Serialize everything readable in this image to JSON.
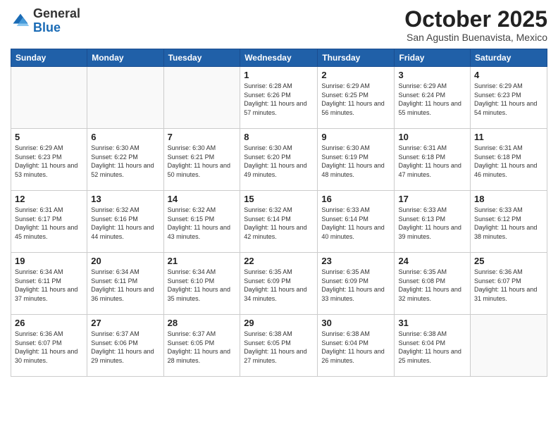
{
  "header": {
    "logo_line1": "General",
    "logo_line2": "Blue",
    "month": "October 2025",
    "location": "San Agustin Buenavista, Mexico"
  },
  "weekdays": [
    "Sunday",
    "Monday",
    "Tuesday",
    "Wednesday",
    "Thursday",
    "Friday",
    "Saturday"
  ],
  "weeks": [
    [
      {
        "day": "",
        "sunrise": "",
        "sunset": "",
        "daylight": ""
      },
      {
        "day": "",
        "sunrise": "",
        "sunset": "",
        "daylight": ""
      },
      {
        "day": "",
        "sunrise": "",
        "sunset": "",
        "daylight": ""
      },
      {
        "day": "1",
        "sunrise": "6:28 AM",
        "sunset": "6:26 PM",
        "daylight": "11 hours and 57 minutes."
      },
      {
        "day": "2",
        "sunrise": "6:29 AM",
        "sunset": "6:25 PM",
        "daylight": "11 hours and 56 minutes."
      },
      {
        "day": "3",
        "sunrise": "6:29 AM",
        "sunset": "6:24 PM",
        "daylight": "11 hours and 55 minutes."
      },
      {
        "day": "4",
        "sunrise": "6:29 AM",
        "sunset": "6:23 PM",
        "daylight": "11 hours and 54 minutes."
      }
    ],
    [
      {
        "day": "5",
        "sunrise": "6:29 AM",
        "sunset": "6:23 PM",
        "daylight": "11 hours and 53 minutes."
      },
      {
        "day": "6",
        "sunrise": "6:30 AM",
        "sunset": "6:22 PM",
        "daylight": "11 hours and 52 minutes."
      },
      {
        "day": "7",
        "sunrise": "6:30 AM",
        "sunset": "6:21 PM",
        "daylight": "11 hours and 50 minutes."
      },
      {
        "day": "8",
        "sunrise": "6:30 AM",
        "sunset": "6:20 PM",
        "daylight": "11 hours and 49 minutes."
      },
      {
        "day": "9",
        "sunrise": "6:30 AM",
        "sunset": "6:19 PM",
        "daylight": "11 hours and 48 minutes."
      },
      {
        "day": "10",
        "sunrise": "6:31 AM",
        "sunset": "6:18 PM",
        "daylight": "11 hours and 47 minutes."
      },
      {
        "day": "11",
        "sunrise": "6:31 AM",
        "sunset": "6:18 PM",
        "daylight": "11 hours and 46 minutes."
      }
    ],
    [
      {
        "day": "12",
        "sunrise": "6:31 AM",
        "sunset": "6:17 PM",
        "daylight": "11 hours and 45 minutes."
      },
      {
        "day": "13",
        "sunrise": "6:32 AM",
        "sunset": "6:16 PM",
        "daylight": "11 hours and 44 minutes."
      },
      {
        "day": "14",
        "sunrise": "6:32 AM",
        "sunset": "6:15 PM",
        "daylight": "11 hours and 43 minutes."
      },
      {
        "day": "15",
        "sunrise": "6:32 AM",
        "sunset": "6:14 PM",
        "daylight": "11 hours and 42 minutes."
      },
      {
        "day": "16",
        "sunrise": "6:33 AM",
        "sunset": "6:14 PM",
        "daylight": "11 hours and 40 minutes."
      },
      {
        "day": "17",
        "sunrise": "6:33 AM",
        "sunset": "6:13 PM",
        "daylight": "11 hours and 39 minutes."
      },
      {
        "day": "18",
        "sunrise": "6:33 AM",
        "sunset": "6:12 PM",
        "daylight": "11 hours and 38 minutes."
      }
    ],
    [
      {
        "day": "19",
        "sunrise": "6:34 AM",
        "sunset": "6:11 PM",
        "daylight": "11 hours and 37 minutes."
      },
      {
        "day": "20",
        "sunrise": "6:34 AM",
        "sunset": "6:11 PM",
        "daylight": "11 hours and 36 minutes."
      },
      {
        "day": "21",
        "sunrise": "6:34 AM",
        "sunset": "6:10 PM",
        "daylight": "11 hours and 35 minutes."
      },
      {
        "day": "22",
        "sunrise": "6:35 AM",
        "sunset": "6:09 PM",
        "daylight": "11 hours and 34 minutes."
      },
      {
        "day": "23",
        "sunrise": "6:35 AM",
        "sunset": "6:09 PM",
        "daylight": "11 hours and 33 minutes."
      },
      {
        "day": "24",
        "sunrise": "6:35 AM",
        "sunset": "6:08 PM",
        "daylight": "11 hours and 32 minutes."
      },
      {
        "day": "25",
        "sunrise": "6:36 AM",
        "sunset": "6:07 PM",
        "daylight": "11 hours and 31 minutes."
      }
    ],
    [
      {
        "day": "26",
        "sunrise": "6:36 AM",
        "sunset": "6:07 PM",
        "daylight": "11 hours and 30 minutes."
      },
      {
        "day": "27",
        "sunrise": "6:37 AM",
        "sunset": "6:06 PM",
        "daylight": "11 hours and 29 minutes."
      },
      {
        "day": "28",
        "sunrise": "6:37 AM",
        "sunset": "6:05 PM",
        "daylight": "11 hours and 28 minutes."
      },
      {
        "day": "29",
        "sunrise": "6:38 AM",
        "sunset": "6:05 PM",
        "daylight": "11 hours and 27 minutes."
      },
      {
        "day": "30",
        "sunrise": "6:38 AM",
        "sunset": "6:04 PM",
        "daylight": "11 hours and 26 minutes."
      },
      {
        "day": "31",
        "sunrise": "6:38 AM",
        "sunset": "6:04 PM",
        "daylight": "11 hours and 25 minutes."
      },
      {
        "day": "",
        "sunrise": "",
        "sunset": "",
        "daylight": ""
      }
    ]
  ],
  "labels": {
    "sunrise_label": "Sunrise:",
    "sunset_label": "Sunset:",
    "daylight_label": "Daylight:"
  }
}
